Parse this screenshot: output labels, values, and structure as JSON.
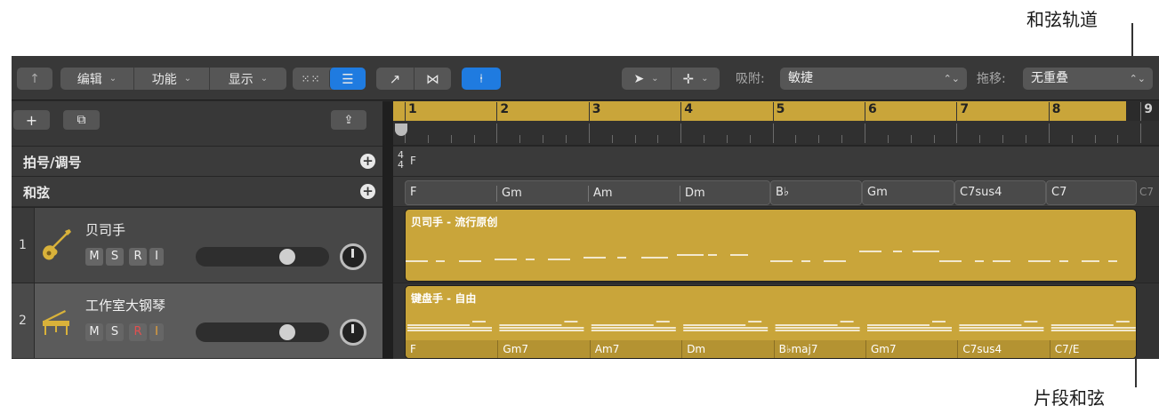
{
  "callouts": {
    "chord_track": "和弦轨道",
    "region_chords": "片段和弦"
  },
  "toolbar": {
    "back_icon": "↑",
    "edit": "编辑",
    "functions": "功能",
    "view": "显示",
    "snap_label": "吸附:",
    "snap_value": "敏捷",
    "drag_label": "拖移:",
    "drag_value": "无重叠"
  },
  "header": {
    "add_icon": "+",
    "duplicate_icon": "⧉",
    "collapse_icon": "⇪"
  },
  "global_tracks": [
    {
      "label": "拍号/调号"
    },
    {
      "label": "和弦"
    }
  ],
  "tracks": [
    {
      "number": "1",
      "name": "贝司手",
      "icon": "bass-guitar-icon",
      "m": "M",
      "s": "S",
      "r": "R",
      "i": "I"
    },
    {
      "number": "2",
      "name": "工作室大钢琴",
      "icon": "grand-piano-icon",
      "m": "M",
      "s": "S",
      "r": "R",
      "i": "I"
    }
  ],
  "ruler": {
    "bars": [
      "1",
      "2",
      "3",
      "4",
      "5",
      "6",
      "7",
      "8",
      "9"
    ]
  },
  "signature": {
    "time_top": "4",
    "time_bottom": "4",
    "key": "F"
  },
  "chord_track": {
    "segments": [
      {
        "chords": [
          "F",
          "Gm",
          "Am",
          "Dm"
        ]
      },
      {
        "chords": [
          "B♭"
        ]
      },
      {
        "chords": [
          "Gm"
        ]
      },
      {
        "chords": [
          "C7sus4"
        ]
      },
      {
        "chords": [
          "C7"
        ]
      }
    ],
    "ghost": "C7"
  },
  "regions": [
    {
      "title": "贝司手 - 流行原创",
      "chords": []
    },
    {
      "title": "键盘手 - 自由",
      "chords": [
        "F",
        "Gm7",
        "Am7",
        "Dm",
        "B♭maj7",
        "Gm7",
        "C7sus4",
        "C7/E"
      ]
    }
  ],
  "colors": {
    "region": "#c9a53a",
    "accent_blue": "#1f7be0",
    "background": "#2b2b2b"
  }
}
